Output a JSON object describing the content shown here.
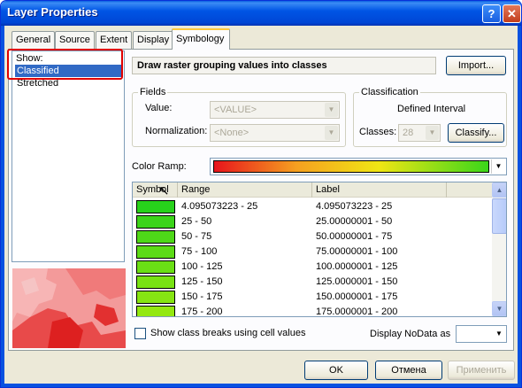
{
  "window": {
    "title": "Layer Properties",
    "help_glyph": "?",
    "close_glyph": "✕"
  },
  "tabs": [
    {
      "label": "General"
    },
    {
      "label": "Source"
    },
    {
      "label": "Extent"
    },
    {
      "label": "Display"
    },
    {
      "label": "Symbology"
    }
  ],
  "show": {
    "label": "Show:",
    "items": [
      "Classified",
      "Stretched"
    ],
    "selected": "Classified"
  },
  "description": "Draw raster grouping values into classes",
  "import_label": "Import...",
  "fields": {
    "group_label": "Fields",
    "value_label": "Value:",
    "value": "<VALUE>",
    "normalization_label": "Normalization:",
    "normalization": "<None>"
  },
  "classification": {
    "group_label": "Classification",
    "method": "Defined Interval",
    "classes_label": "Classes:",
    "classes_value": "28",
    "classify_label": "Classify..."
  },
  "color_ramp_label": "Color Ramp:",
  "table": {
    "headers": [
      "Symbol",
      "Range",
      "Label"
    ],
    "rows": [
      {
        "range": "4.095073223 - 25",
        "label": "4.095073223 - 25",
        "color": "#27d21b"
      },
      {
        "range": "25 - 50",
        "label": "25.00000001 - 50",
        "color": "#3bd41a"
      },
      {
        "range": "50 - 75",
        "label": "50.00000001 - 75",
        "color": "#4ed818"
      },
      {
        "range": "75 - 100",
        "label": "75.00000001 - 100",
        "color": "#5cdb16"
      },
      {
        "range": "100 - 125",
        "label": "100.0000001 - 125",
        "color": "#6adf15"
      },
      {
        "range": "125 - 150",
        "label": "125.0000001 - 150",
        "color": "#78e213"
      },
      {
        "range": "150 - 175",
        "label": "150.0000001 - 175",
        "color": "#86e512"
      },
      {
        "range": "175 - 200",
        "label": "175.0000001 - 200",
        "color": "#94e810"
      }
    ]
  },
  "show_breaks_label": "Show class breaks using cell values",
  "display_nodata_label": "Display NoData as",
  "buttons": {
    "ok": "OK",
    "cancel": "Отмена",
    "apply": "Применить"
  }
}
